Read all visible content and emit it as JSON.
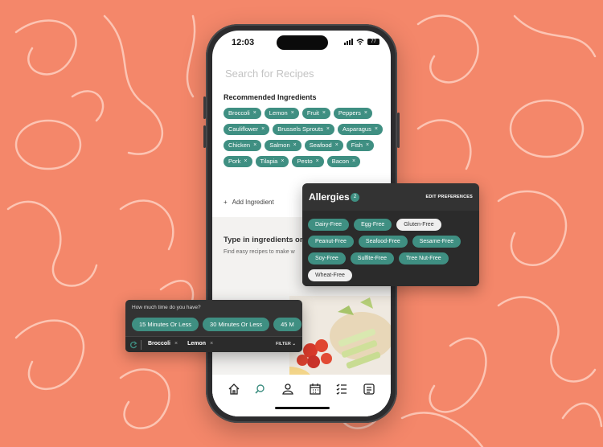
{
  "status_bar": {
    "time": "12:03",
    "battery": "77"
  },
  "search": {
    "placeholder": "Search for Recipes"
  },
  "recommended": {
    "title": "Recommended Ingredients",
    "chips": [
      "Broccoli",
      "Lemon",
      "Fruit",
      "Peppers",
      "Cauliflower",
      "Brussels Sprouts",
      "Asparagus",
      "Chicken",
      "Salmon",
      "Seafood",
      "Fish",
      "Pork",
      "Tilapia",
      "Pesto",
      "Bacon"
    ],
    "remove_glyph": "×",
    "add_label": "Add Ingredient",
    "add_glyph": "+"
  },
  "prompt": {
    "title": "Type in ingredients or d",
    "subtitle": "Find easy recipes to make w"
  },
  "allergies": {
    "title": "Allergies",
    "count": "2",
    "edit_label": "EDIT PREFERENCES",
    "chips": [
      {
        "label": "Dairy-Free",
        "selected": true
      },
      {
        "label": "Egg-Free",
        "selected": true
      },
      {
        "label": "Gluten-Free",
        "selected": false
      },
      {
        "label": "Peanut-Free",
        "selected": true
      },
      {
        "label": "Seafood-Free",
        "selected": true
      },
      {
        "label": "Sesame-Free",
        "selected": true
      },
      {
        "label": "Soy-Free",
        "selected": true
      },
      {
        "label": "Sulfite-Free",
        "selected": true
      },
      {
        "label": "Tree Nut-Free",
        "selected": true
      },
      {
        "label": "Wheat-Free",
        "selected": false
      }
    ]
  },
  "time_filter": {
    "question": "How much time do you have?",
    "options": [
      "15 Minutes Or Less",
      "30 Minutes Or Less",
      "45 M"
    ],
    "selected_tags": [
      "Broccoli",
      "Lemon"
    ],
    "filter_label": "FILTER",
    "filter_glyph": "⌄"
  },
  "tab_bar": {
    "icons": [
      "home-icon",
      "search-icon",
      "profile-icon",
      "calendar-icon",
      "checklist-icon",
      "feed-icon"
    ]
  },
  "colors": {
    "background": "#f4876a",
    "accent": "#3f8f82",
    "panel": "#333333"
  }
}
